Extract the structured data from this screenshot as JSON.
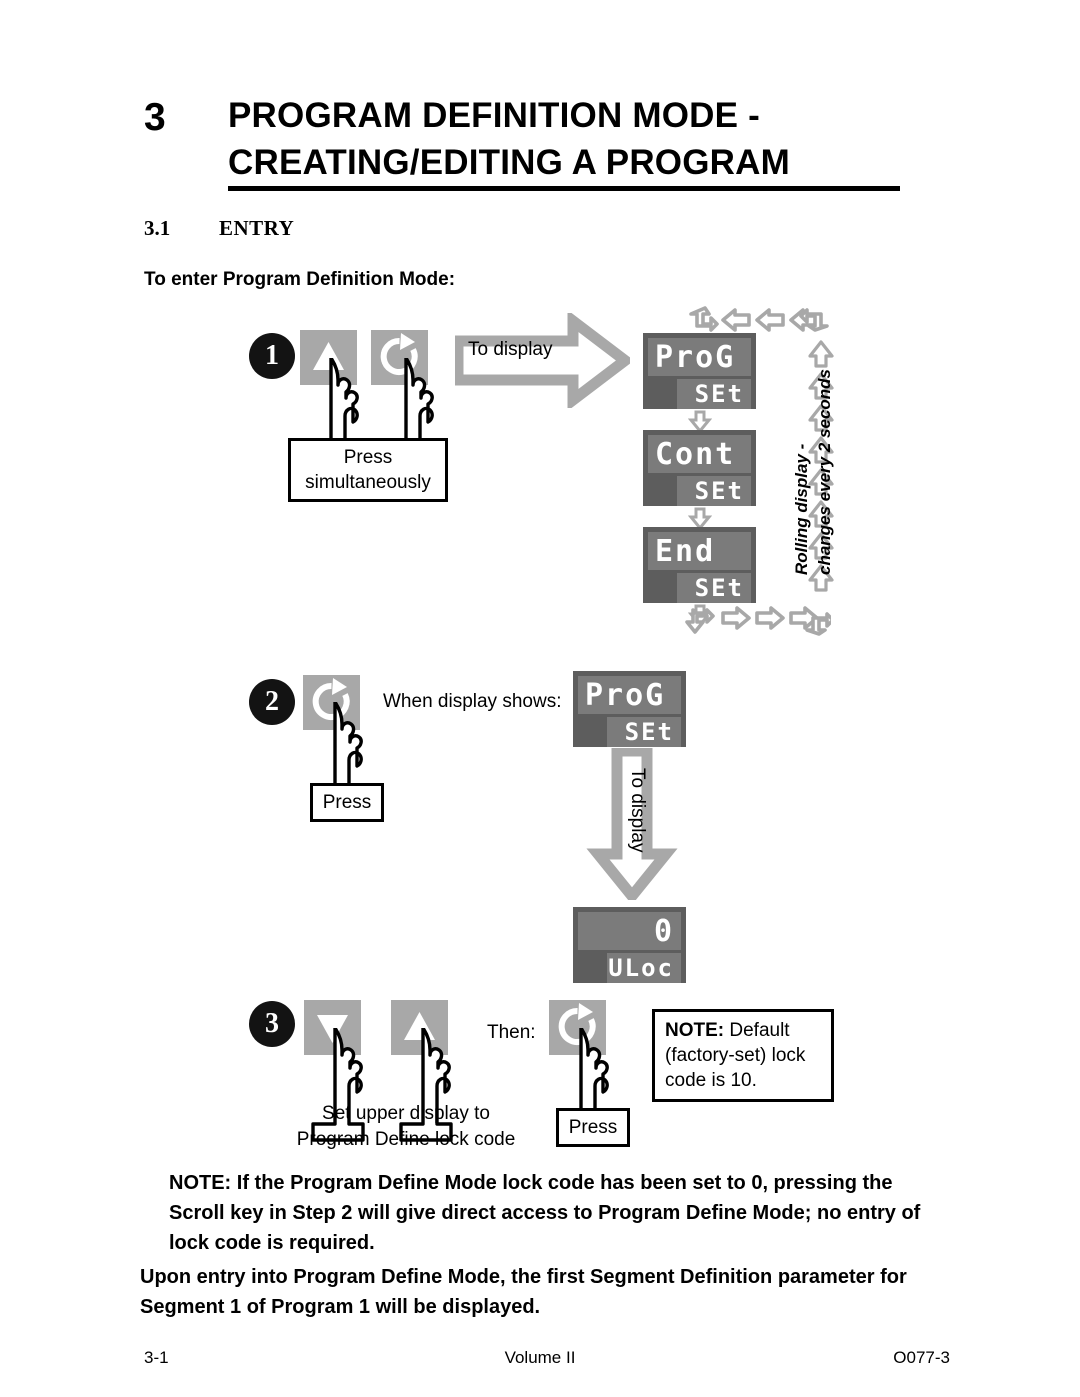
{
  "header": {
    "chapter_number": "3",
    "chapter_title": "PROGRAM DEFINITION MODE - CREATING/EDITING A PROGRAM",
    "section_number": "3.1",
    "section_title": "ENTRY",
    "intro": "To enter Program Definition Mode:"
  },
  "step1": {
    "number": "1",
    "keys": [
      {
        "icon": "up-arrow-icon",
        "name": "up-key"
      },
      {
        "icon": "scroll-icon",
        "name": "scroll-key"
      }
    ],
    "caption": "Press\nsimultaneously",
    "caption_line1": "Press",
    "caption_line2": "simultaneously",
    "arrow_label": "To display",
    "rolling_note_line1": "Rolling display -",
    "rolling_note_line2": "changes every 2 seconds",
    "displays": [
      {
        "upper": "ProG",
        "lower": "SEt"
      },
      {
        "upper": "Cont",
        "lower": "SEt"
      },
      {
        "upper": "End",
        "lower": "SEt"
      }
    ]
  },
  "step2": {
    "number": "2",
    "key_icon": "scroll-icon",
    "press_label": "Press",
    "when_label": "When display shows:",
    "display": {
      "upper": "ProG",
      "lower": "SEt"
    },
    "arrow_label": "To display",
    "result_display": {
      "upper": "0",
      "lower": "ULoc"
    }
  },
  "step3": {
    "number": "3",
    "keys": [
      {
        "icon": "down-arrow-icon",
        "name": "down-key"
      },
      {
        "icon": "up-arrow-icon",
        "name": "up-key"
      }
    ],
    "caption_line1": "Set upper display to",
    "caption_line2": "Program Define lock code",
    "then_label": "Then:",
    "scroll_key_icon": "scroll-icon",
    "press_label": "Press",
    "note_bold": "NOTE:",
    "note_rest": " Default",
    "note_line2": "(factory-set) lock",
    "note_line3": "code is 10."
  },
  "body": {
    "note_paragraph": "NOTE: If the Program Define Mode lock code has been set to 0, pressing the Scroll key in Step 2 will give direct access to Program Define Mode; no entry of lock code is required.",
    "final_paragraph": "Upon entry into Program Define Mode, the first Segment Definition parameter for Segment 1 of Program 1 will be displayed."
  },
  "footer": {
    "left": "3-1",
    "center": "Volume II",
    "right": "O077-3"
  },
  "colors": {
    "key_gray": "#a8a8a8",
    "lcd_frame": "#5d5d5d",
    "lcd_segment": "#7b7b7b",
    "arrow_gray": "#a8a8a8",
    "badge": "#131313"
  }
}
